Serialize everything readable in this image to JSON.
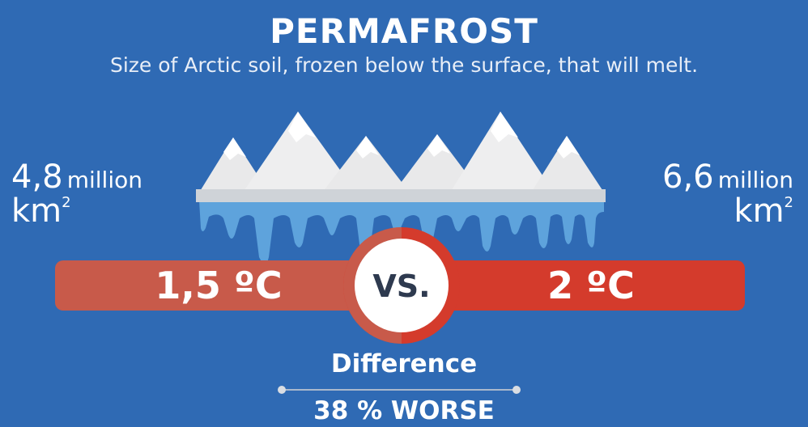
{
  "header": {
    "title": "PERMAFROST",
    "subtitle": "Size of Arctic soil, frozen below the surface, that will melt."
  },
  "scenarios": {
    "left": {
      "number": "4,8",
      "word": "million",
      "unit": "km",
      "exponent": "2",
      "temperature": "1,5 ºC"
    },
    "right": {
      "number": "6,6",
      "word": "million",
      "unit": "km",
      "exponent": "2",
      "temperature": "2 ºC"
    }
  },
  "comparison": {
    "vs_label": "VS.",
    "difference_label": "Difference",
    "difference_value": "38 % WORSE"
  },
  "colors": {
    "background": "#2f6ab4",
    "bar_left": "#c85a4a",
    "bar_right": "#d43b2c",
    "ice_white": "#f2f2f2",
    "ice_shadow": "#cfd3d8",
    "melt_blue": "#5ea3dc"
  }
}
